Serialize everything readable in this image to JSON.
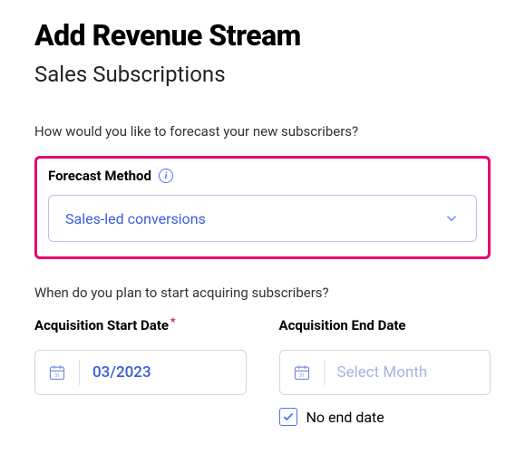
{
  "title": "Add Revenue Stream",
  "subtitle": "Sales Subscriptions",
  "forecast": {
    "question": "How would you like to forecast your new subscribers?",
    "label": "Forecast Method",
    "selected": "Sales-led conversions"
  },
  "acquisition": {
    "question": "When do you plan to start acquiring subscribers?",
    "start_label": "Acquisition Start Date",
    "end_label": "Acquisition End Date",
    "start_value": "03/2023",
    "end_placeholder": "Select Month",
    "no_end_label": "No end date",
    "no_end_checked": true
  }
}
